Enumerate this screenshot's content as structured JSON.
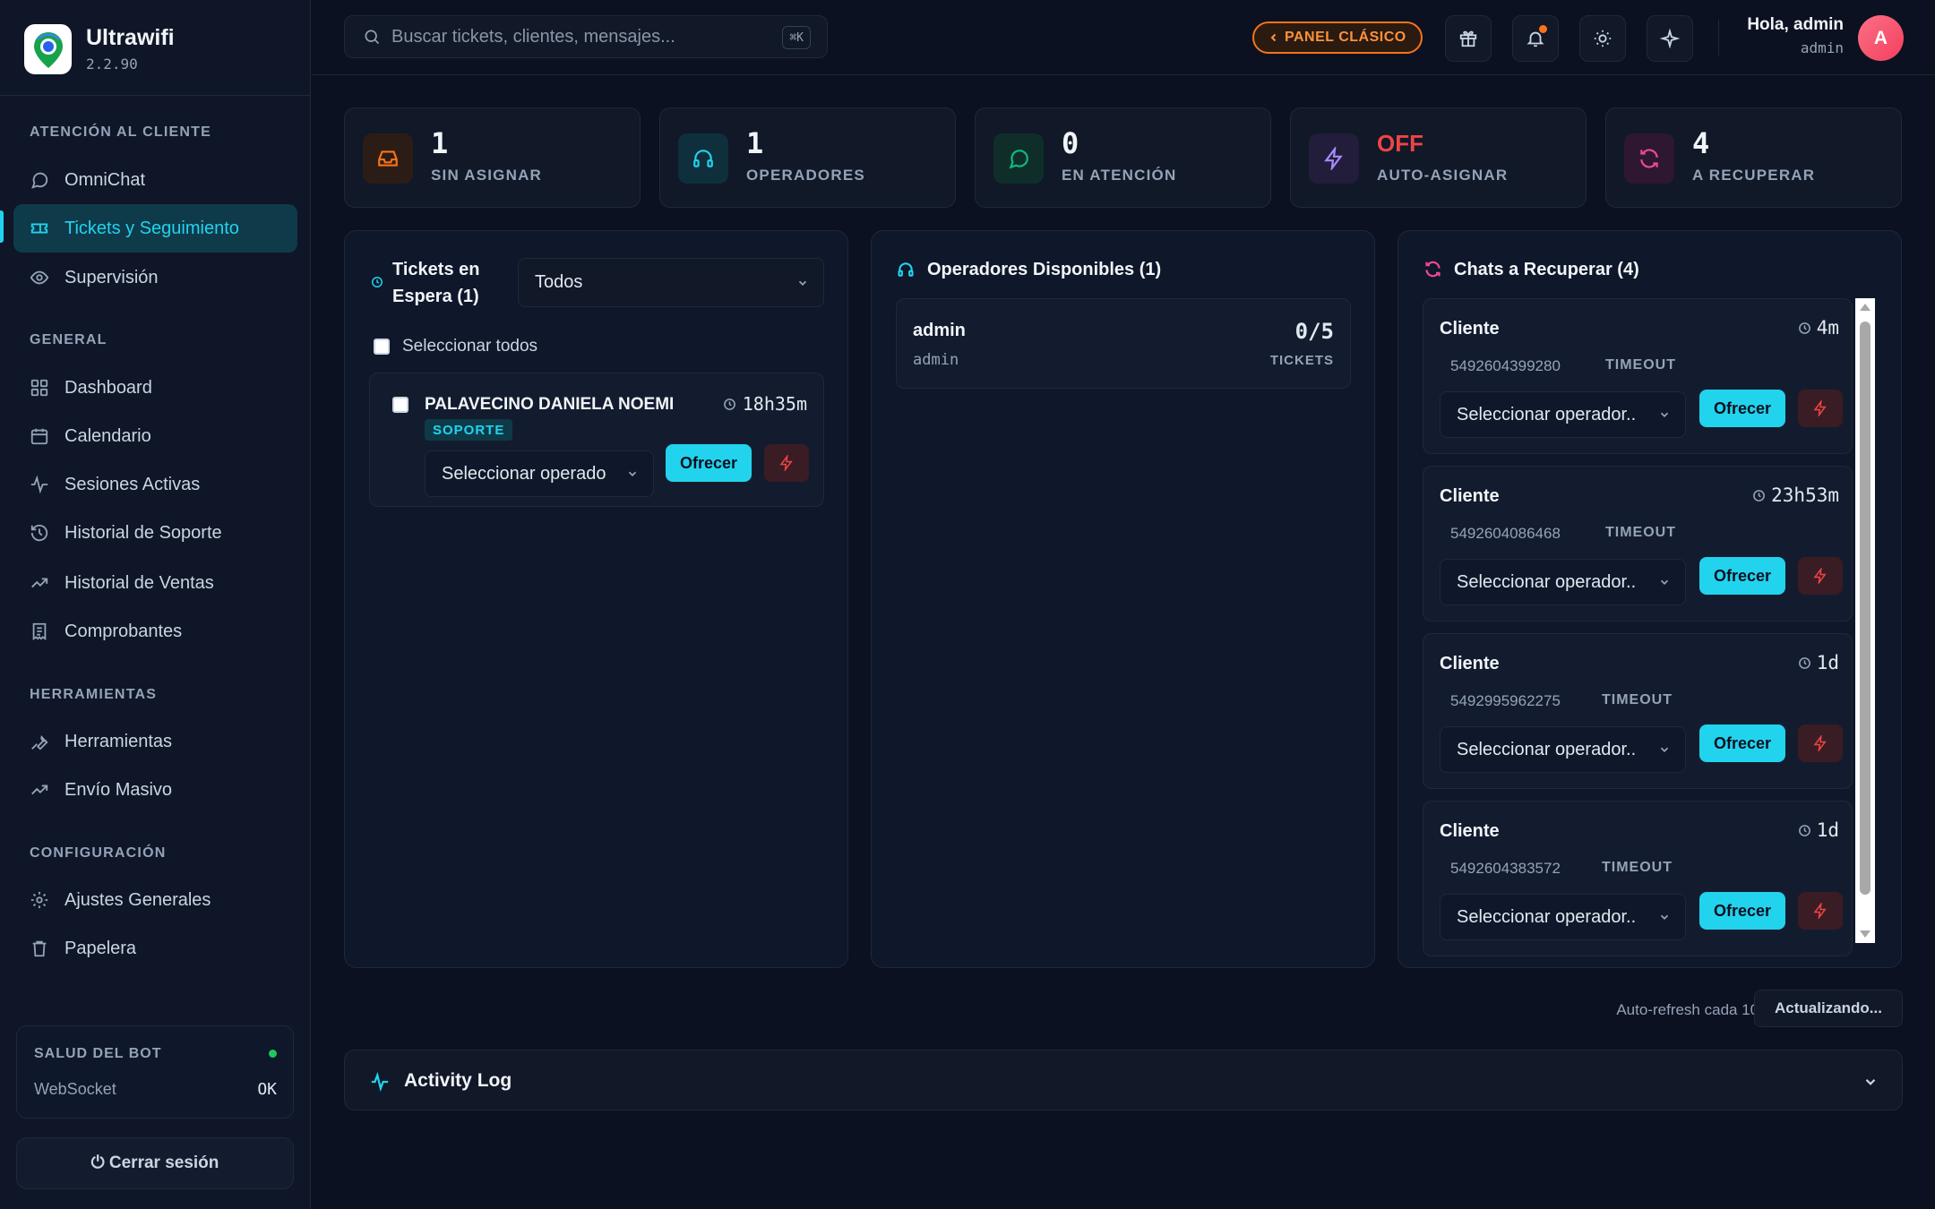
{
  "brand": {
    "name": "Ultrawifi",
    "version": "2.2.90"
  },
  "sidebar": {
    "sections": [
      {
        "title": "ATENCIÓN AL CLIENTE"
      },
      {
        "title": "GENERAL"
      },
      {
        "title": "HERRAMIENTAS"
      },
      {
        "title": "CONFIGURACIÓN"
      }
    ],
    "items": [
      {
        "label": "OmniChat",
        "icon": "chat-bubble-icon"
      },
      {
        "label": "Tickets y Seguimiento",
        "icon": "ticket-icon",
        "active": true
      },
      {
        "label": "Supervisión",
        "icon": "eye-icon"
      },
      {
        "label": "Dashboard",
        "icon": "grid-icon"
      },
      {
        "label": "Calendario",
        "icon": "calendar-icon"
      },
      {
        "label": "Sesiones Activas",
        "icon": "pulse-icon"
      },
      {
        "label": "Historial de Soporte",
        "icon": "history-icon"
      },
      {
        "label": "Historial de Ventas",
        "icon": "trending-up-icon"
      },
      {
        "label": "Comprobantes",
        "icon": "receipt-icon"
      },
      {
        "label": "Herramientas",
        "icon": "wrench-icon"
      },
      {
        "label": "Envío Masivo",
        "icon": "trending-up-icon"
      },
      {
        "label": "Ajustes Generales",
        "icon": "gear-icon"
      },
      {
        "label": "Papelera",
        "icon": "trash-icon"
      }
    ],
    "health": {
      "title": "SALUD DEL BOT",
      "ws_label": "WebSocket",
      "ws_value": "OK"
    },
    "logout": "⏻ Cerrar sesión"
  },
  "header": {
    "search_placeholder": "Buscar tickets, clientes, mensajes...",
    "search_kbd": "⌘K",
    "panel_button": "PANEL CLÁSICO",
    "greeting": "Hola, admin",
    "role": "admin",
    "avatar_initial": "A"
  },
  "stats": [
    {
      "value": "1",
      "label": "SIN ASIGNAR",
      "color": "#f97316"
    },
    {
      "value": "1",
      "label": "OPERADORES",
      "color": "#22d3ee"
    },
    {
      "value": "0",
      "label": "EN ATENCIÓN",
      "color": "#10b981"
    },
    {
      "value": "OFF",
      "label": "AUTO-ASIGNAR",
      "color": "#a78bfa"
    },
    {
      "value": "4",
      "label": "A RECUPERAR",
      "color": "#ec4899"
    }
  ],
  "tickets_panel": {
    "title": "Tickets en Espera (1)",
    "filter": "Todos",
    "select_all": "Seleccionar todos",
    "tickets": [
      {
        "name": "PALAVECINO DANIELA NOEMI",
        "time": "18h35m",
        "tag": "SOPORTE",
        "select_placeholder": "Seleccionar operado",
        "offer": "Ofrecer"
      }
    ]
  },
  "operators_panel": {
    "title": "Operadores Disponibles (1)",
    "operators": [
      {
        "name": "admin",
        "user": "admin",
        "count": "0/5",
        "unit": "TICKETS"
      }
    ]
  },
  "recover_panel": {
    "title": "Chats a Recuperar (4)",
    "chats": [
      {
        "name": "Cliente",
        "time": "4m",
        "phone": "5492604399280",
        "status": "TIMEOUT",
        "select_placeholder": "Seleccionar operador..",
        "offer": "Ofrecer"
      },
      {
        "name": "Cliente",
        "time": "23h53m",
        "phone": "5492604086468",
        "status": "TIMEOUT",
        "select_placeholder": "Seleccionar operador..",
        "offer": "Ofrecer"
      },
      {
        "name": "Cliente",
        "time": "1d",
        "phone": "5492995962275",
        "status": "TIMEOUT",
        "select_placeholder": "Seleccionar operador..",
        "offer": "Ofrecer"
      },
      {
        "name": "Cliente",
        "time": "1d",
        "phone": "5492604383572",
        "status": "TIMEOUT",
        "select_placeholder": "Seleccionar operador..",
        "offer": "Ofrecer"
      }
    ]
  },
  "footer": {
    "auto_refresh": "Auto-refresh cada 10s ·",
    "updating": "Actualizando..."
  },
  "activity_log": {
    "title": "Activity Log"
  },
  "colors": {
    "accent": "#22d3ee",
    "background": "#0b1120",
    "danger": "#ef4444",
    "warning": "#f97316"
  }
}
